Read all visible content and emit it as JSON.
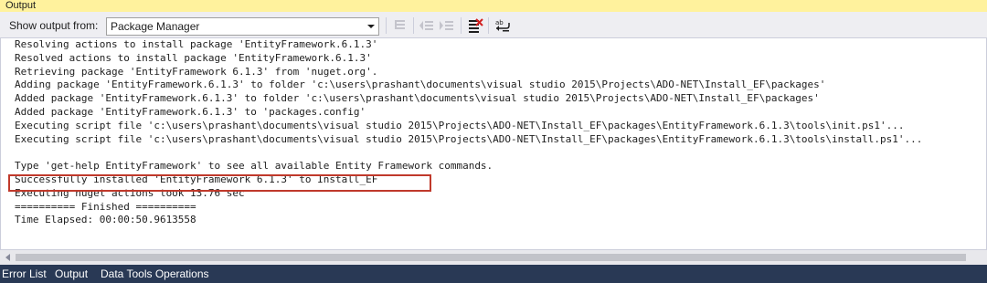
{
  "window": {
    "title": "Output"
  },
  "toolbar": {
    "show_output_label": "Show output from:",
    "source_selected": "Package Manager",
    "buttons": [
      {
        "icon": "find-message-icon",
        "enabled": false
      },
      {
        "icon": "go-to-previous-message-icon",
        "enabled": false
      },
      {
        "icon": "go-to-next-message-icon",
        "enabled": false
      },
      {
        "icon": "clear-all-icon",
        "enabled": true
      },
      {
        "icon": "toggle-word-wrap-icon",
        "enabled": true
      }
    ]
  },
  "output": {
    "lines": [
      "Resolving actions to install package 'EntityFramework.6.1.3'",
      "Resolved actions to install package 'EntityFramework.6.1.3'",
      "Retrieving package 'EntityFramework 6.1.3' from 'nuget.org'.",
      "Adding package 'EntityFramework.6.1.3' to folder 'c:\\users\\prashant\\documents\\visual studio 2015\\Projects\\ADO-NET\\Install_EF\\packages'",
      "Added package 'EntityFramework.6.1.3' to folder 'c:\\users\\prashant\\documents\\visual studio 2015\\Projects\\ADO-NET\\Install_EF\\packages'",
      "Added package 'EntityFramework.6.1.3' to 'packages.config'",
      "Executing script file 'c:\\users\\prashant\\documents\\visual studio 2015\\Projects\\ADO-NET\\Install_EF\\packages\\EntityFramework.6.1.3\\tools\\init.ps1'...",
      "Executing script file 'c:\\users\\prashant\\documents\\visual studio 2015\\Projects\\ADO-NET\\Install_EF\\packages\\EntityFramework.6.1.3\\tools\\install.ps1'...",
      "",
      "Type 'get-help EntityFramework' to see all available Entity Framework commands.",
      "Successfully installed 'EntityFramework 6.1.3' to Install_EF",
      "Executing nuget actions took 13.76 sec",
      "========== Finished ==========",
      "Time Elapsed: 00:00:50.9613558"
    ],
    "highlighted_line_index": 10,
    "highlight_color": "#c0392b"
  },
  "tabs": [
    {
      "label": "Error List"
    },
    {
      "label": "Output"
    },
    {
      "label": "Data Tools Operations"
    }
  ],
  "colors": {
    "title_bar": "#fff29d",
    "tab_bar": "#293955",
    "text": "#1e1e1e"
  }
}
